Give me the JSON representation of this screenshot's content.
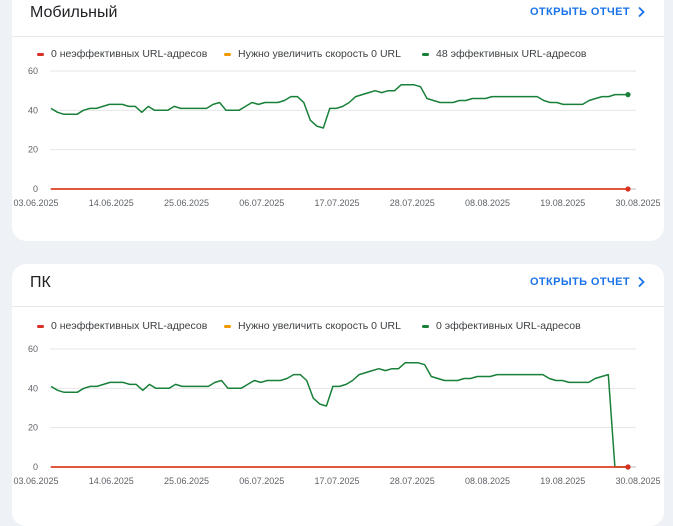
{
  "colors": {
    "poor": "#d93025",
    "improve": "#f29900",
    "good": "#188038",
    "accent": "#1a73e8",
    "grid": "#e6e6e6"
  },
  "cards": [
    {
      "title": "Мобильный",
      "open_label": "ОТКРЫТЬ ОТЧЕТ",
      "open_icon": "chevron-right-icon",
      "legend": [
        "0 неэффективных URL-адресов",
        "Нужно увеличить скорость 0 URL",
        "48 эффективных URL-адресов"
      ]
    },
    {
      "title": "ПК",
      "open_label": "ОТКРЫТЬ ОТЧЕТ",
      "open_icon": "chevron-right-icon",
      "legend": [
        "0 неэффективных URL-адресов",
        "Нужно увеличить скорость 0 URL",
        "0 эффективных URL-адресов"
      ]
    }
  ],
  "chart_data": [
    {
      "type": "line",
      "x_ticks": [
        "03.06.2025",
        "14.06.2025",
        "25.06.2025",
        "06.07.2025",
        "17.07.2025",
        "28.07.2025",
        "08.08.2025",
        "19.08.2025",
        "30.08.2025"
      ],
      "y_ticks": [
        0,
        20,
        40,
        60
      ],
      "ylim": [
        0,
        60
      ],
      "grid": true,
      "legend_position": "top",
      "series": [
        {
          "name": "0 неэффективных URL-адресов",
          "values": [
            0,
            0,
            0,
            0,
            0,
            0,
            0,
            0,
            0,
            0,
            0,
            0,
            0,
            0,
            0,
            0,
            0,
            0,
            0,
            0,
            0,
            0,
            0,
            0,
            0,
            0,
            0,
            0,
            0,
            0,
            0,
            0,
            0,
            0,
            0,
            0,
            0,
            0,
            0,
            0,
            0,
            0,
            0,
            0,
            0,
            0,
            0,
            0,
            0,
            0,
            0,
            0,
            0,
            0,
            0,
            0,
            0,
            0,
            0,
            0,
            0,
            0,
            0,
            0,
            0,
            0,
            0,
            0,
            0,
            0,
            0,
            0,
            0,
            0,
            0,
            0,
            0,
            0,
            0,
            0,
            0,
            0,
            0,
            0,
            0,
            0,
            0,
            0,
            0
          ]
        },
        {
          "name": "Нужно увеличить скорость 0 URL",
          "values": [
            0,
            0,
            0,
            0,
            0,
            0,
            0,
            0,
            0,
            0,
            0,
            0,
            0,
            0,
            0,
            0,
            0,
            0,
            0,
            0,
            0,
            0,
            0,
            0,
            0,
            0,
            0,
            0,
            0,
            0,
            0,
            0,
            0,
            0,
            0,
            0,
            0,
            0,
            0,
            0,
            0,
            0,
            0,
            0,
            0,
            0,
            0,
            0,
            0,
            0,
            0,
            0,
            0,
            0,
            0,
            0,
            0,
            0,
            0,
            0,
            0,
            0,
            0,
            0,
            0,
            0,
            0,
            0,
            0,
            0,
            0,
            0,
            0,
            0,
            0,
            0,
            0,
            0,
            0,
            0,
            0,
            0,
            0,
            0,
            0,
            0,
            0,
            0,
            0
          ]
        },
        {
          "name": "48 эффективных URL-адресов",
          "values": [
            41,
            39,
            38,
            38,
            38,
            40,
            41,
            41,
            42,
            43,
            43,
            43,
            42,
            42,
            39,
            42,
            40,
            40,
            40,
            42,
            41,
            41,
            41,
            41,
            41,
            43,
            44,
            40,
            40,
            40,
            42,
            44,
            43,
            44,
            44,
            44,
            45,
            47,
            47,
            44,
            35,
            32,
            31,
            41,
            41,
            42,
            44,
            47,
            48,
            49,
            50,
            49,
            50,
            50,
            53,
            53,
            53,
            52,
            46,
            45,
            44,
            44,
            44,
            45,
            45,
            46,
            46,
            46,
            47,
            47,
            47,
            47,
            47,
            47,
            47,
            47,
            45,
            44,
            44,
            43,
            43,
            43,
            43,
            45,
            46,
            47,
            47,
            48,
            48,
            48
          ]
        }
      ]
    },
    {
      "type": "line",
      "x_ticks": [
        "03.06.2025",
        "14.06.2025",
        "25.06.2025",
        "06.07.2025",
        "17.07.2025",
        "28.07.2025",
        "08.08.2025",
        "19.08.2025",
        "30.08.2025"
      ],
      "y_ticks": [
        0,
        20,
        40,
        60
      ],
      "ylim": [
        0,
        60
      ],
      "grid": true,
      "legend_position": "top",
      "series": [
        {
          "name": "0 неэффективных URL-адресов",
          "values": [
            0,
            0,
            0,
            0,
            0,
            0,
            0,
            0,
            0,
            0,
            0,
            0,
            0,
            0,
            0,
            0,
            0,
            0,
            0,
            0,
            0,
            0,
            0,
            0,
            0,
            0,
            0,
            0,
            0,
            0,
            0,
            0,
            0,
            0,
            0,
            0,
            0,
            0,
            0,
            0,
            0,
            0,
            0,
            0,
            0,
            0,
            0,
            0,
            0,
            0,
            0,
            0,
            0,
            0,
            0,
            0,
            0,
            0,
            0,
            0,
            0,
            0,
            0,
            0,
            0,
            0,
            0,
            0,
            0,
            0,
            0,
            0,
            0,
            0,
            0,
            0,
            0,
            0,
            0,
            0,
            0,
            0,
            0,
            0,
            0,
            0,
            0,
            0,
            0
          ]
        },
        {
          "name": "Нужно увеличить скорость 0 URL",
          "values": [
            0,
            0,
            0,
            0,
            0,
            0,
            0,
            0,
            0,
            0,
            0,
            0,
            0,
            0,
            0,
            0,
            0,
            0,
            0,
            0,
            0,
            0,
            0,
            0,
            0,
            0,
            0,
            0,
            0,
            0,
            0,
            0,
            0,
            0,
            0,
            0,
            0,
            0,
            0,
            0,
            0,
            0,
            0,
            0,
            0,
            0,
            0,
            0,
            0,
            0,
            0,
            0,
            0,
            0,
            0,
            0,
            0,
            0,
            0,
            0,
            0,
            0,
            0,
            0,
            0,
            0,
            0,
            0,
            0,
            0,
            0,
            0,
            0,
            0,
            0,
            0,
            0,
            0,
            0,
            0,
            0,
            0,
            0,
            0,
            0,
            0,
            0,
            0,
            0
          ]
        },
        {
          "name": "0 эффективных URL-адресов",
          "values": [
            41,
            39,
            38,
            38,
            38,
            40,
            41,
            41,
            42,
            43,
            43,
            43,
            42,
            42,
            39,
            42,
            40,
            40,
            40,
            42,
            41,
            41,
            41,
            41,
            41,
            43,
            44,
            40,
            40,
            40,
            42,
            44,
            43,
            44,
            44,
            44,
            45,
            47,
            47,
            44,
            35,
            32,
            31,
            41,
            41,
            42,
            44,
            47,
            48,
            49,
            50,
            49,
            50,
            50,
            53,
            53,
            53,
            52,
            46,
            45,
            44,
            44,
            44,
            45,
            45,
            46,
            46,
            46,
            47,
            47,
            47,
            47,
            47,
            47,
            47,
            47,
            45,
            44,
            44,
            43,
            43,
            43,
            43,
            45,
            46,
            47,
            0,
            0,
            0
          ]
        }
      ]
    }
  ]
}
